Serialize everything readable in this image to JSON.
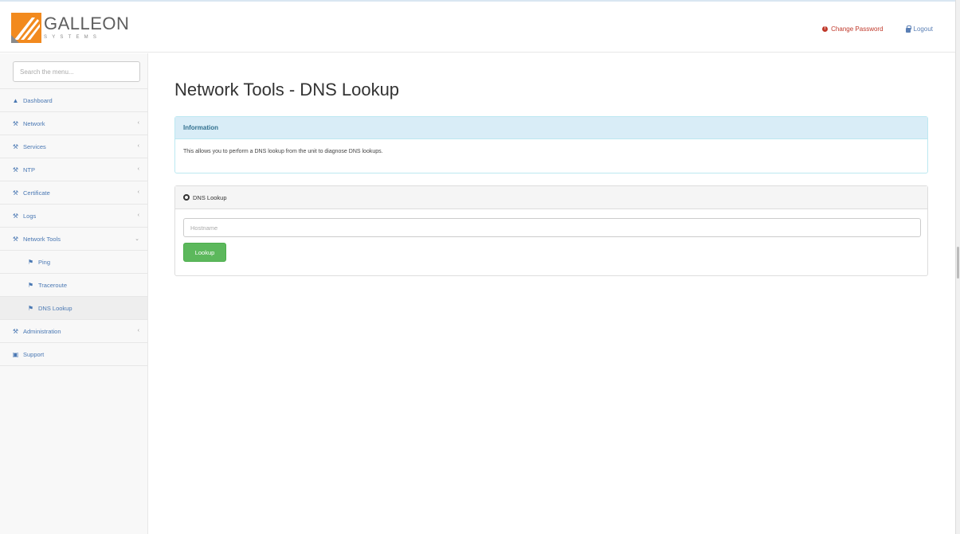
{
  "header": {
    "logo_word": "GALLEON",
    "logo_sub": "SYSTEMS",
    "change_password": "Change Password",
    "logout": "Logout",
    "change_password_color": "#c0392b",
    "logout_color": "#5a7fb5"
  },
  "sidebar": {
    "search_placeholder": "Search the menu...",
    "items": [
      {
        "label": "Dashboard",
        "icon": "dashboard-icon",
        "has_chevron": false
      },
      {
        "label": "Network",
        "icon": "wrench-icon",
        "has_chevron": true
      },
      {
        "label": "Services",
        "icon": "wrench-icon",
        "has_chevron": true
      },
      {
        "label": "NTP",
        "icon": "wrench-icon",
        "has_chevron": true
      },
      {
        "label": "Certificate",
        "icon": "wrench-icon",
        "has_chevron": true
      },
      {
        "label": "Logs",
        "icon": "wrench-icon",
        "has_chevron": true
      },
      {
        "label": "Network Tools",
        "icon": "wrench-icon",
        "has_chevron": true,
        "expanded": true
      },
      {
        "label": "Ping",
        "icon": "flag-icon",
        "sub": true
      },
      {
        "label": "Traceroute",
        "icon": "flag-icon",
        "sub": true
      },
      {
        "label": "DNS Lookup",
        "icon": "flag-icon",
        "sub": true,
        "active": true
      },
      {
        "label": "Administration",
        "icon": "wrench-icon",
        "has_chevron": true
      },
      {
        "label": "Support",
        "icon": "support-icon",
        "has_chevron": false
      }
    ]
  },
  "main": {
    "title": "Network Tools - DNS Lookup",
    "info_panel": {
      "heading": "Information",
      "body": "This allows you to perform a DNS lookup from the unit to diagnose DNS lookups."
    },
    "dns_panel": {
      "heading": "DNS Lookup",
      "input_placeholder": "Hostname",
      "button_label": "Lookup",
      "button_color": "#5cb85c"
    }
  }
}
